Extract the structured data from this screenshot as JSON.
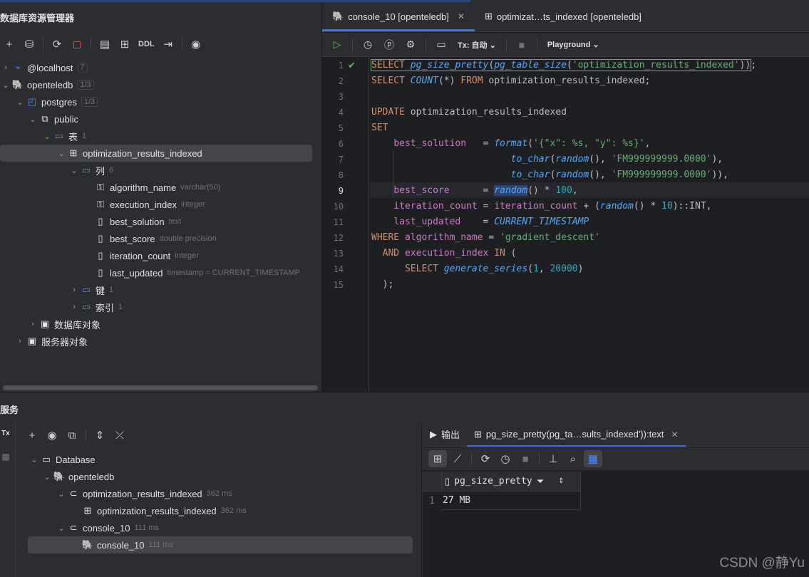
{
  "db_explorer": {
    "title": "数据库资源管理器",
    "toolbar": {
      "ddl_label": "DDL"
    },
    "tree": [
      {
        "label": "@localhost",
        "badge": "7"
      },
      {
        "label": "openteledb",
        "badge": "1/3"
      },
      {
        "label": "postgres",
        "badge": "1/3"
      },
      {
        "label": "public"
      },
      {
        "label": "表",
        "hint": "1"
      },
      {
        "label": "optimization_results_indexed"
      },
      {
        "label": "列",
        "hint": "6"
      },
      {
        "label": "algorithm_name",
        "hint": "varchar(50)"
      },
      {
        "label": "execution_index",
        "hint": "integer"
      },
      {
        "label": "best_solution",
        "hint": "text"
      },
      {
        "label": "best_score",
        "hint": "double precision"
      },
      {
        "label": "iteration_count",
        "hint": "integer"
      },
      {
        "label": "last_updated",
        "hint": "timestamp = CURRENT_TIMESTAMP"
      },
      {
        "label": "键",
        "hint": "1"
      },
      {
        "label": "索引",
        "hint": "1"
      },
      {
        "label": "数据库对象"
      },
      {
        "label": "服务器对象"
      }
    ]
  },
  "editor": {
    "tabs": [
      {
        "label": "console_10 [openteledb]"
      },
      {
        "label": "optimizat…ts_indexed [openteledb]"
      }
    ],
    "toolbar": {
      "tx_label": "Tx: 自动",
      "playground_label": "Playground"
    },
    "line_numbers": [
      "1",
      "2",
      "3",
      "4",
      "5",
      "6",
      "7",
      "8",
      "9",
      "10",
      "11",
      "12",
      "13",
      "14",
      "15"
    ],
    "current_line": 9
  },
  "services": {
    "title": "服务",
    "side_label": "Tx",
    "tree": [
      {
        "label": "Database"
      },
      {
        "label": "openteledb"
      },
      {
        "label": "optimization_results_indexed",
        "hint": "362 ms"
      },
      {
        "label": "optimization_results_indexed",
        "hint": "362 ms"
      },
      {
        "label": "console_10",
        "hint": "111 ms"
      },
      {
        "label": "console_10",
        "hint": "111 ms"
      }
    ],
    "output_tabs": [
      {
        "label": "输出"
      },
      {
        "label": "pg_size_pretty(pg_ta…sults_indexed')):text"
      }
    ],
    "grid": {
      "column": "pg_size_pretty",
      "rows": [
        {
          "num": "1",
          "value": "27 MB"
        }
      ]
    }
  },
  "watermark": "CSDN @静Yu"
}
